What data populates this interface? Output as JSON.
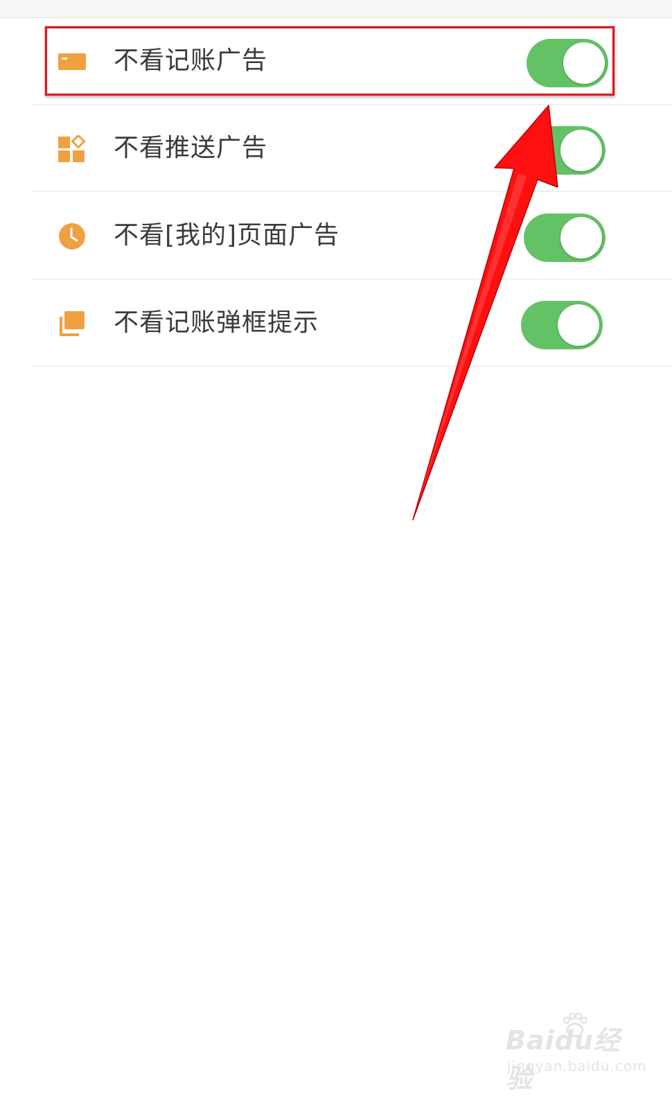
{
  "settings": {
    "items": [
      {
        "label": "不看记账广告",
        "icon": "card-icon",
        "enabled": true
      },
      {
        "label": "不看推送广告",
        "icon": "apps-grid-icon",
        "enabled": true
      },
      {
        "label": "不看[我的]页面广告",
        "icon": "clock-icon",
        "enabled": true
      },
      {
        "label": "不看记账弹框提示",
        "icon": "layers-icon",
        "enabled": true
      }
    ]
  },
  "colors": {
    "accent_orange": "#f0a040",
    "toggle_on": "#63c266",
    "annotation_red": "#e0141e"
  },
  "watermark": {
    "brand": "Baidu经验",
    "url": "jingyan.baidu.com"
  }
}
